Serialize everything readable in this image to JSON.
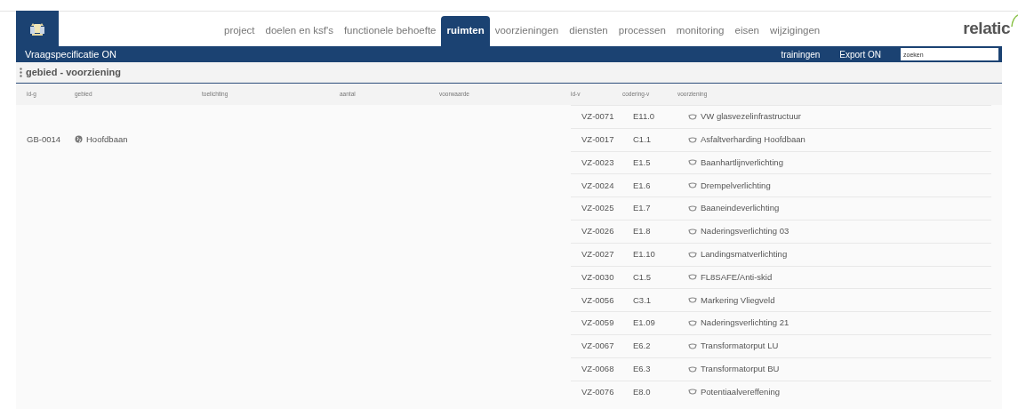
{
  "nav": {
    "items": [
      {
        "label": "project",
        "selected": false
      },
      {
        "label": "doelen en ksf's",
        "selected": false
      },
      {
        "label": "functionele behoefte",
        "selected": false
      },
      {
        "label": "ruimten",
        "selected": true
      },
      {
        "label": "voorzieningen",
        "selected": false
      },
      {
        "label": "diensten",
        "selected": false
      },
      {
        "label": "processen",
        "selected": false
      },
      {
        "label": "monitoring",
        "selected": false
      },
      {
        "label": "eisen",
        "selected": false
      },
      {
        "label": "wijzigingen",
        "selected": false
      }
    ],
    "brand": "relatic"
  },
  "bar": {
    "title": "Vraagspecificatie ON",
    "links": [
      "trainingen",
      "Export ON"
    ],
    "search": {
      "value": "zoeken"
    }
  },
  "section": {
    "title": "gebied - voorziening"
  },
  "table": {
    "columns": [
      "id-g",
      "gebied",
      "toelichting",
      "aantal",
      "voorwaarde",
      "id-v",
      "codering-v",
      "voorziening"
    ],
    "rows": [
      {
        "id_v": "VZ-0071",
        "codering": "E11.0",
        "voorziening": "VW glasvezelinfrastructuur"
      },
      {
        "id_g": "GB-0014",
        "gebied": "Hoofdbaan",
        "id_v": "VZ-0017",
        "codering": "C1.1",
        "voorziening": "Asfaltverharding Hoofdbaan"
      },
      {
        "id_v": "VZ-0023",
        "codering": "E1.5",
        "voorziening": "Baanhartlijnverlichting"
      },
      {
        "id_v": "VZ-0024",
        "codering": "E1.6",
        "voorziening": "Drempelverlichting"
      },
      {
        "id_v": "VZ-0025",
        "codering": "E1.7",
        "voorziening": "Baaneindeverlichting"
      },
      {
        "id_v": "VZ-0026",
        "codering": "E1.8",
        "voorziening": "Naderingsverlichting 03"
      },
      {
        "id_v": "VZ-0027",
        "codering": "E1.10",
        "voorziening": "Landingsmatverlichting"
      },
      {
        "id_v": "VZ-0030",
        "codering": "C1.5",
        "voorziening": "FL8SAFE/Anti-skid"
      },
      {
        "id_v": "VZ-0056",
        "codering": "C3.1",
        "voorziening": "Markering Vliegveld"
      },
      {
        "id_v": "VZ-0059",
        "codering": "E1.09",
        "voorziening": "Naderingsverlichting 21"
      },
      {
        "id_v": "VZ-0067",
        "codering": "E6.2",
        "voorziening": "Transformatorput LU"
      },
      {
        "id_v": "VZ-0068",
        "codering": "E6.3",
        "voorziening": "Transformatorput BU"
      },
      {
        "id_v": "VZ-0076",
        "codering": "E8.0",
        "voorziening": "Potentiaalvereffening"
      }
    ]
  }
}
